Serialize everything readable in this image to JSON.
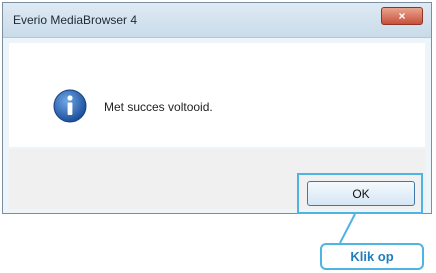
{
  "window": {
    "title": "Everio MediaBrowser 4",
    "close_glyph": "×"
  },
  "dialog": {
    "message": "Met succes voltooid.",
    "icon": "info-icon"
  },
  "buttons": {
    "ok_label": "OK"
  },
  "annotation": {
    "callout_label": "Klik op",
    "highlight_color": "#4fb4e2",
    "text_color": "#1f7ec0"
  }
}
